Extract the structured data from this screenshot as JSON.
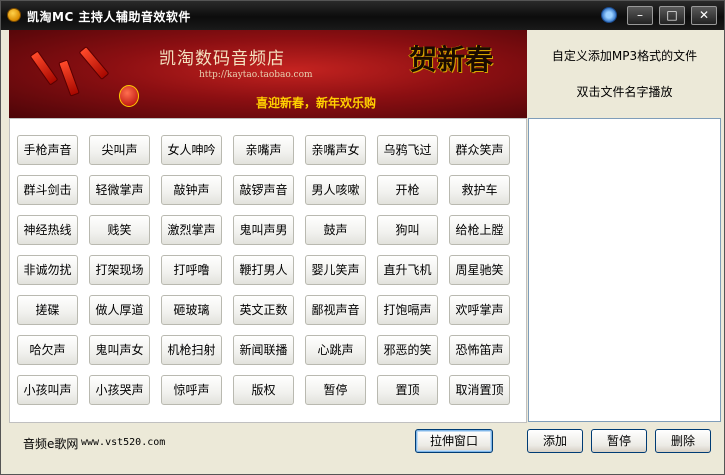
{
  "window": {
    "title": "凯淘MC 主持人辅助音效软件",
    "minimize_glyph": "–",
    "maximize_glyph": "□",
    "close_glyph": "✕"
  },
  "banner": {
    "title": "凯淘数码音频店",
    "url": "http://kaytao.taobao.com",
    "slogan": "喜迎新春，新年欢乐购",
    "big_text": "贺新春"
  },
  "right_panel": {
    "hint_add": "自定义添加MP3格式的文件",
    "hint_play": "双击文件名字播放",
    "files": []
  },
  "sound_buttons": [
    "手枪声音",
    "尖叫声",
    "女人呻吟",
    "亲嘴声",
    "亲嘴声女",
    "乌鸦飞过",
    "群众笑声",
    "群斗剑击",
    "轻微掌声",
    "敲钟声",
    "敲锣声音",
    "男人咳嗽",
    "开枪",
    "救护车",
    "神经热线",
    "贱笑",
    "激烈掌声",
    "鬼叫声男",
    "鼓声",
    "狗叫",
    "给枪上膛",
    "非诚勿扰",
    "打架现场",
    "打呼噜",
    "鞭打男人",
    "婴儿笑声",
    "直升飞机",
    "周星驰笑",
    "搓碟",
    "做人厚道",
    "砸玻璃",
    "英文正数",
    "鄙视声音",
    "打饱嗝声",
    "欢呼掌声",
    "哈欠声",
    "鬼叫声女",
    "机枪扫射",
    "新闻联播",
    "心跳声",
    "邪恶的笑",
    "恐怖笛声",
    "小孩叫声",
    "小孩哭声",
    "惊呼声",
    "版权",
    "暂停",
    "置顶",
    "取消置顶"
  ],
  "footer": {
    "site_label": "音频e歌网",
    "site_url": "www.vst520.com",
    "stretch_label": "拉伸窗口",
    "add_label": "添加",
    "pause_label": "暂停",
    "delete_label": "删除"
  }
}
